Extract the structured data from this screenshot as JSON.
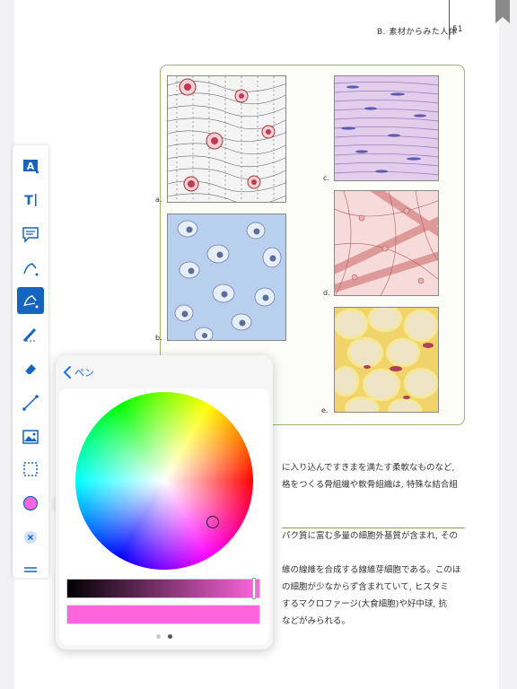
{
  "page": {
    "header_title": "B. 素材からみた人体",
    "page_number": "51"
  },
  "figure": {
    "labels": [
      "a.",
      "b.",
      "c.",
      "d.",
      "e."
    ]
  },
  "body_text": {
    "lines": [
      "に入り込んですきまを満たす柔軟なものなど,",
      "格をつくる骨組織や軟骨組織は, 特殊な結合組",
      "",
      "",
      "パク質に富む多量の細胞外基質が含まれ, その",
      "",
      "維の線維を合成する線維芽細胞である。このほ",
      "の細胞が少なからず含まれていて, ヒスタミ",
      "するマクロファージ(大食細胞)や好中球, 抗",
      "などがみられる。"
    ]
  },
  "toolbar": {
    "tools": [
      {
        "name": "text-highlight-tool-icon",
        "active": false
      },
      {
        "name": "text-insert-tool-icon",
        "active": false
      },
      {
        "name": "comment-tool-icon",
        "active": false
      },
      {
        "name": "pen-tool-icon",
        "active": false
      },
      {
        "name": "pen-settings-tool-icon",
        "active": true
      },
      {
        "name": "highlighter-tool-icon",
        "active": false
      },
      {
        "name": "eraser-tool-icon",
        "active": false
      },
      {
        "name": "line-tool-icon",
        "active": false
      },
      {
        "name": "image-tool-icon",
        "active": false
      },
      {
        "name": "selection-tool-icon",
        "active": false
      },
      {
        "name": "color-tool-icon",
        "active": false
      },
      {
        "name": "clear-tool-icon",
        "active": false
      },
      {
        "name": "menu-icon",
        "active": false
      }
    ]
  },
  "color_picker": {
    "back_label": "ペン",
    "selected_color": "#ff66dd",
    "brightness_level": 0.98,
    "page_index": 2,
    "page_count": 2
  },
  "colors": {
    "accent": "#1565c0",
    "link": "#1a73e8",
    "frame": "#9fb07a"
  }
}
